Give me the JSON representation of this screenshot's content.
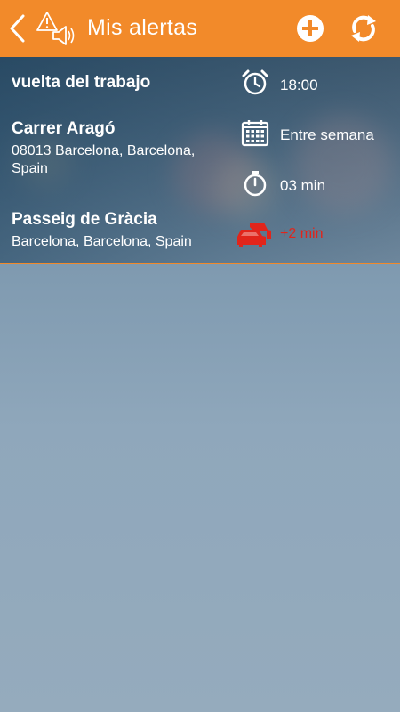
{
  "header": {
    "title": "Mis alertas"
  },
  "alert": {
    "name": "vuelta del trabajo",
    "origin": {
      "name": "Carrer Aragó",
      "address_line1": "08013 Barcelona,  Barcelona,",
      "address_line2": "Spain"
    },
    "destination": {
      "name": "Passeig de Gràcia",
      "address": "Barcelona,  Barcelona,  Spain"
    },
    "time": "18:00",
    "days": "Entre semana",
    "duration": "03 min",
    "traffic_delay": "+2 min"
  },
  "colors": {
    "accent": "#f28a2a",
    "delay": "#e1251b"
  },
  "icons": [
    "back-arrow-icon",
    "traffic-alert-logo-icon",
    "add-icon",
    "refresh-icon",
    "alarm-clock-icon",
    "calendar-icon",
    "stopwatch-icon",
    "traffic-cars-icon"
  ]
}
